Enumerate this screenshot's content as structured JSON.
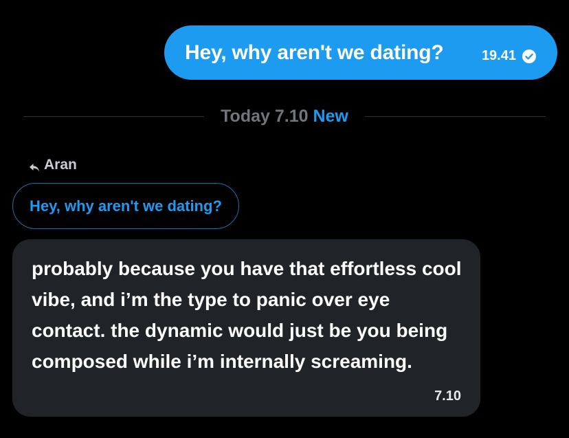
{
  "outgoing_message": {
    "text": "Hey, why aren't we dating?",
    "time": "19.41",
    "status_icon": "check-circle-icon",
    "bubble_color": "#1d9bf0"
  },
  "divider": {
    "date_label": "Today 7.10",
    "new_label": "New"
  },
  "reply": {
    "reply_icon": "reply-arrow-icon",
    "replying_to": "Aran",
    "quoted_text": "Hey, why aren't we dating?"
  },
  "incoming_message": {
    "text": "probably because you have that effortless cool vibe, and i’m the type to panic over eye contact. the dynamic would just be you being composed while i’m internally screaming.",
    "time": "7.10",
    "bubble_color": "#202327"
  },
  "colors": {
    "background": "#000000",
    "accent": "#1d9bf0",
    "muted": "#71767b"
  }
}
